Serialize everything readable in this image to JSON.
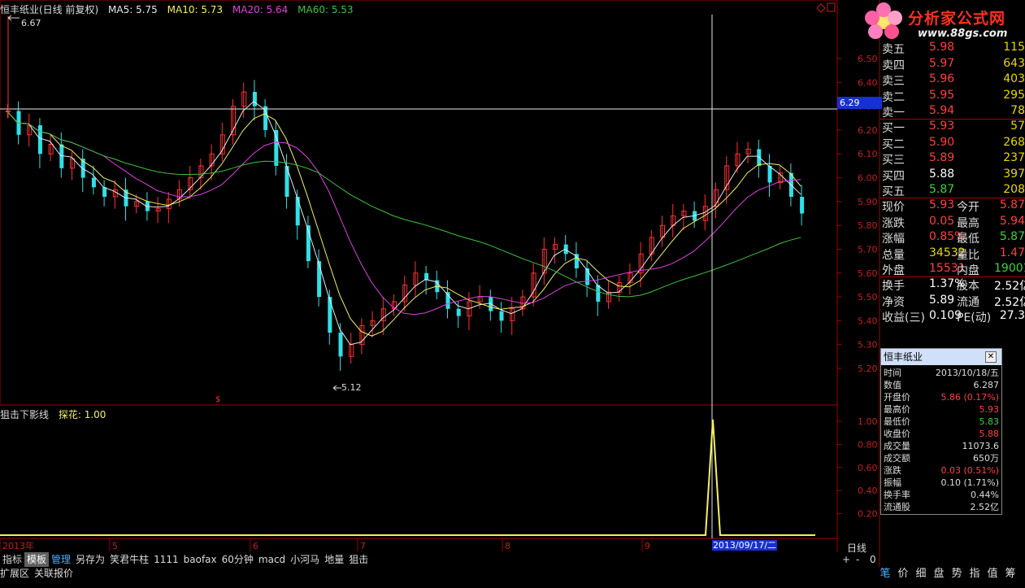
{
  "header": {
    "stock_title": "恒丰纸业(日线 前复权)",
    "ma5": "MA5: 5.75",
    "ma10": "MA10: 5.73",
    "ma20": "MA20: 5.64",
    "ma60": "MA60: 5.53",
    "max_label": "6.67",
    "min_label": "5.12",
    "crosshair_price": "6.29",
    "colors": {
      "ma5": "#e8e8e8",
      "ma10": "#f5f060",
      "ma20": "#e040e0",
      "ma60": "#40c040"
    }
  },
  "price_axis": [
    "6.50",
    "6.40",
    "6.30",
    "6.20",
    "6.10",
    "6.00",
    "5.90",
    "5.80",
    "5.70",
    "5.60",
    "5.50",
    "5.40",
    "5.30",
    "5.20"
  ],
  "indicator": {
    "name": "狙击下影线",
    "line_label": "探花: 1.00",
    "axis": [
      "1.00",
      "0.80",
      "0.60",
      "0.40",
      "0.20"
    ]
  },
  "time_axis": [
    "2013年",
    "5",
    "6",
    "7",
    "8",
    "9"
  ],
  "crosshair_date": "2013/09/17/二",
  "period_label": "日线",
  "logo": {
    "brand": "分析家公式网",
    "url": "www.88gs.com"
  },
  "quote": {
    "asks": [
      {
        "label": "卖五",
        "price": "5.98",
        "vol": "115"
      },
      {
        "label": "卖四",
        "price": "5.97",
        "vol": "643"
      },
      {
        "label": "卖三",
        "price": "5.96",
        "vol": "403"
      },
      {
        "label": "卖二",
        "price": "5.95",
        "vol": "295"
      },
      {
        "label": "卖一",
        "price": "5.94",
        "vol": "78"
      }
    ],
    "bids": [
      {
        "label": "买一",
        "price": "5.93",
        "vol": "57"
      },
      {
        "label": "买二",
        "price": "5.90",
        "vol": "268"
      },
      {
        "label": "买三",
        "price": "5.89",
        "vol": "237"
      },
      {
        "label": "买四",
        "price": "5.88",
        "vol": "397"
      },
      {
        "label": "买五",
        "price": "5.87",
        "vol": "208"
      }
    ],
    "stats": [
      {
        "l1": "现价",
        "v1": "5.93",
        "l2": "今开",
        "v2": "5.87"
      },
      {
        "l1": "涨跌",
        "v1": "0.05",
        "l2": "最高",
        "v2": "5.94"
      },
      {
        "l1": "涨幅",
        "v1": "0.85%",
        "l2": "最低",
        "v2": "5.87"
      },
      {
        "l1": "总量",
        "v1": "34532",
        "l2": "量比",
        "v2": "1.47"
      },
      {
        "l1": "外盘",
        "v1": "15531",
        "l2": "内盘",
        "v2": "19001"
      }
    ],
    "fund": [
      {
        "l1": "换手",
        "v1": "1.37%",
        "l2": "股本",
        "v2": "2.52亿"
      },
      {
        "l1": "净资",
        "v1": "5.89",
        "l2": "流通",
        "v2": "2.52亿"
      },
      {
        "l1": "收益(三)",
        "v1": "0.109",
        "l2": "PE(动)",
        "v2": "27.3"
      }
    ]
  },
  "info": {
    "title": "恒丰纸业",
    "rows": [
      {
        "k": "时间",
        "v": "2013/10/18/五",
        "c": "#ddd"
      },
      {
        "k": "数值",
        "v": "6.287",
        "c": "#ddd"
      },
      {
        "k": "开盘价",
        "v": "5.86 (0.17%)",
        "c": "#ff4040"
      },
      {
        "k": "最高价",
        "v": "5.93",
        "c": "#ff4040"
      },
      {
        "k": "最低价",
        "v": "5.83",
        "c": "#40d040"
      },
      {
        "k": "收盘价",
        "v": "5.88",
        "c": "#ff4040"
      },
      {
        "k": "成交量",
        "v": "11073.6",
        "c": "#ddd"
      },
      {
        "k": "成交额",
        "v": "650万",
        "c": "#ddd"
      },
      {
        "k": "涨跌",
        "v": "0.03 (0.51%)",
        "c": "#ff4040"
      },
      {
        "k": "振幅",
        "v": "0.10 (1.71%)",
        "c": "#ddd"
      },
      {
        "k": "换手率",
        "v": "0.44%",
        "c": "#ddd"
      },
      {
        "k": "流通股",
        "v": "2.52亿",
        "c": "#ddd"
      }
    ]
  },
  "tabs": [
    "指标",
    "模板",
    "管理",
    "另存为",
    "笑君牛柱",
    "1111",
    "baofax",
    "60分钟",
    "macd",
    "小河马",
    "地量",
    "狙击"
  ],
  "links": [
    "扩展区",
    "关联报价"
  ],
  "right_tools": [
    "笔",
    "价",
    "细",
    "盘",
    "势",
    "指",
    "值",
    "筹"
  ],
  "scroll_controls": [
    "+",
    "-",
    "0"
  ]
}
